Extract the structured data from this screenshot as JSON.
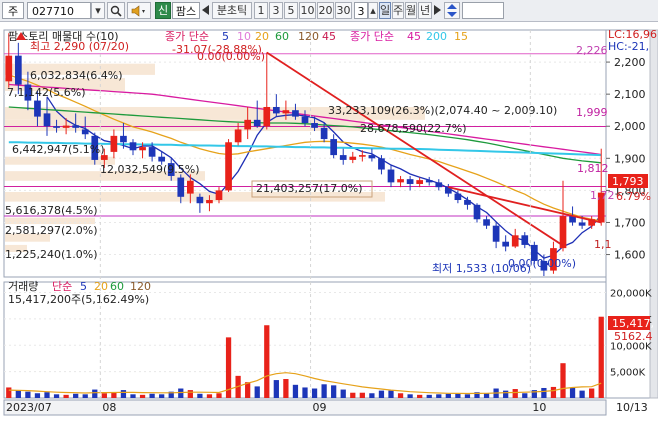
{
  "toolbar": {
    "market": "주",
    "code": "027710",
    "search_icon": "magnifier-icon",
    "sound_icon": "speaker-icon",
    "new_badge": "신",
    "stock_name": "팜스",
    "prev_icon": "triangle-left-icon",
    "tick_label": "분초틱",
    "intervals": [
      "1",
      "3",
      "5",
      "10",
      "20",
      "30"
    ],
    "interval_value": "3",
    "period_tabs": [
      "일",
      "주",
      "월",
      "년"
    ],
    "next_icon": "triangle-right-icon",
    "updown_icon": "updown-arrow-icon"
  },
  "colors": {
    "up": "#e8221a",
    "down": "#1d36b8",
    "ma5": "#1e2fb5",
    "ma10": "#e07bd8",
    "ma20": "#e6a21a",
    "ma60": "#1e9a3c",
    "ma120": "#8a5a2b",
    "ma45": "#d81ba0",
    "ma200": "#33c7e8",
    "trend": "#e02020"
  },
  "chart_data": {
    "type": "candlestick",
    "price_panel": {
      "legend_title": "팜스토리 매물대 수(10)",
      "ma_simple_label": "종가 단순",
      "ma_simple_periods": [
        "5",
        "10",
        "20",
        "60",
        "120"
      ],
      "ma_long_label": "종가 단순",
      "ma_long_periods": [
        "45",
        "200",
        "15"
      ],
      "corner_lc": "LC:16,96",
      "corner_hc": "HC:-21,",
      "y_ticks": [
        "2,200",
        "2,100",
        "2,000",
        "1,900",
        "1,800",
        "1,700",
        "1,600"
      ],
      "ylim": [
        1530,
        2300
      ],
      "high_annotation": "최고 2,290 (07/20)",
      "high_change": "-31.07(-28.88%)",
      "high_zero": "0.00(0.00%)",
      "low_annotation": "최저 1,533 (10/06)",
      "low_change": "0.00(0.00%)",
      "level_labels": {
        "l2226": "2,226",
        "l1999": "1,999",
        "l1812": "1,812",
        "l1793": "1,793",
        "l1720": "1,72",
        "l1628": "1,1",
        "pct": "6.79%"
      },
      "volume_profile": [
        {
          "label": "6,032,834(6.4%)"
        },
        {
          "label": "7,1,142(5.6%)"
        },
        {
          "label": "33,233,109(26.3%)(2,074.40 ~ 2,009.10)"
        },
        {
          "label": "28,678,590(22.7%)"
        },
        {
          "label": "6,442,947(5.1%)"
        },
        {
          "label": "12,032,549(9.5%)"
        },
        {
          "label": "21,403,257(17.0%)"
        },
        {
          "label": "5,616,378(4.5%)"
        },
        {
          "label": "2,581,297(2.0%)"
        },
        {
          "label": "1,225,240(1.0%)"
        }
      ],
      "candles": [
        {
          "o": 2140,
          "h": 2290,
          "l": 2120,
          "c": 2220
        },
        {
          "o": 2220,
          "h": 2260,
          "l": 2100,
          "c": 2130
        },
        {
          "o": 2130,
          "h": 2170,
          "l": 2050,
          "c": 2080
        },
        {
          "o": 2080,
          "h": 2110,
          "l": 2000,
          "c": 2030
        },
        {
          "o": 2040,
          "h": 2090,
          "l": 1970,
          "c": 2000
        },
        {
          "o": 2000,
          "h": 2020,
          "l": 1980,
          "c": 1995
        },
        {
          "o": 1995,
          "h": 2025,
          "l": 1975,
          "c": 2002
        },
        {
          "o": 2003,
          "h": 2040,
          "l": 1980,
          "c": 1995
        },
        {
          "o": 1990,
          "h": 2030,
          "l": 1960,
          "c": 1975
        },
        {
          "o": 1970,
          "h": 1980,
          "l": 1880,
          "c": 1895
        },
        {
          "o": 1895,
          "h": 1930,
          "l": 1870,
          "c": 1910
        },
        {
          "o": 1920,
          "h": 1990,
          "l": 1900,
          "c": 1970
        },
        {
          "o": 1970,
          "h": 2010,
          "l": 1930,
          "c": 1950
        },
        {
          "o": 1950,
          "h": 1960,
          "l": 1910,
          "c": 1925
        },
        {
          "o": 1925,
          "h": 1950,
          "l": 1900,
          "c": 1935
        },
        {
          "o": 1935,
          "h": 1950,
          "l": 1890,
          "c": 1905
        },
        {
          "o": 1905,
          "h": 1920,
          "l": 1880,
          "c": 1890
        },
        {
          "o": 1885,
          "h": 1900,
          "l": 1830,
          "c": 1845
        },
        {
          "o": 1840,
          "h": 1850,
          "l": 1760,
          "c": 1780
        },
        {
          "o": 1790,
          "h": 1850,
          "l": 1760,
          "c": 1830
        },
        {
          "o": 1780,
          "h": 1790,
          "l": 1730,
          "c": 1760
        },
        {
          "o": 1760,
          "h": 1785,
          "l": 1735,
          "c": 1770
        },
        {
          "o": 1770,
          "h": 1810,
          "l": 1760,
          "c": 1800
        },
        {
          "o": 1800,
          "h": 1960,
          "l": 1795,
          "c": 1950
        },
        {
          "o": 1950,
          "h": 2010,
          "l": 1940,
          "c": 1990
        },
        {
          "o": 1990,
          "h": 2060,
          "l": 1960,
          "c": 2020
        },
        {
          "o": 2020,
          "h": 2080,
          "l": 1995,
          "c": 2000
        },
        {
          "o": 2000,
          "h": 2230,
          "l": 1990,
          "c": 2060
        },
        {
          "o": 2060,
          "h": 2100,
          "l": 2030,
          "c": 2040
        },
        {
          "o": 2040,
          "h": 2080,
          "l": 2020,
          "c": 2050
        },
        {
          "o": 2050,
          "h": 2070,
          "l": 2020,
          "c": 2030
        },
        {
          "o": 2030,
          "h": 2050,
          "l": 2000,
          "c": 2010
        },
        {
          "o": 2010,
          "h": 2030,
          "l": 1985,
          "c": 1995
        },
        {
          "o": 1995,
          "h": 2010,
          "l": 1950,
          "c": 1960
        },
        {
          "o": 1960,
          "h": 1975,
          "l": 1900,
          "c": 1910
        },
        {
          "o": 1910,
          "h": 1930,
          "l": 1880,
          "c": 1895
        },
        {
          "o": 1895,
          "h": 1920,
          "l": 1885,
          "c": 1905
        },
        {
          "o": 1905,
          "h": 1925,
          "l": 1890,
          "c": 1910
        },
        {
          "o": 1910,
          "h": 1930,
          "l": 1890,
          "c": 1900
        },
        {
          "o": 1900,
          "h": 1910,
          "l": 1850,
          "c": 1865
        },
        {
          "o": 1865,
          "h": 1880,
          "l": 1810,
          "c": 1825
        },
        {
          "o": 1825,
          "h": 1845,
          "l": 1810,
          "c": 1835
        },
        {
          "o": 1835,
          "h": 1845,
          "l": 1800,
          "c": 1820
        },
        {
          "o": 1820,
          "h": 1840,
          "l": 1810,
          "c": 1832
        },
        {
          "o": 1832,
          "h": 1842,
          "l": 1815,
          "c": 1825
        },
        {
          "o": 1825,
          "h": 1835,
          "l": 1800,
          "c": 1810
        },
        {
          "o": 1810,
          "h": 1820,
          "l": 1780,
          "c": 1790
        },
        {
          "o": 1790,
          "h": 1800,
          "l": 1760,
          "c": 1770
        },
        {
          "o": 1770,
          "h": 1780,
          "l": 1740,
          "c": 1755
        },
        {
          "o": 1755,
          "h": 1760,
          "l": 1700,
          "c": 1710
        },
        {
          "o": 1710,
          "h": 1720,
          "l": 1680,
          "c": 1690
        },
        {
          "o": 1690,
          "h": 1700,
          "l": 1620,
          "c": 1640
        },
        {
          "o": 1640,
          "h": 1660,
          "l": 1610,
          "c": 1625
        },
        {
          "o": 1625,
          "h": 1680,
          "l": 1620,
          "c": 1660
        },
        {
          "o": 1660,
          "h": 1670,
          "l": 1620,
          "c": 1630
        },
        {
          "o": 1630,
          "h": 1640,
          "l": 1570,
          "c": 1580
        },
        {
          "o": 1580,
          "h": 1600,
          "l": 1533,
          "c": 1550
        },
        {
          "o": 1550,
          "h": 1640,
          "l": 1540,
          "c": 1620
        },
        {
          "o": 1620,
          "h": 1830,
          "l": 1610,
          "c": 1720
        },
        {
          "o": 1720,
          "h": 1750,
          "l": 1690,
          "c": 1700
        },
        {
          "o": 1700,
          "h": 1720,
          "l": 1680,
          "c": 1690
        },
        {
          "o": 1690,
          "h": 1720,
          "l": 1680,
          "c": 1710
        },
        {
          "o": 1700,
          "h": 1930,
          "l": 1690,
          "c": 1793
        }
      ],
      "ma_series": [
        {
          "key": "ma5",
          "values": [
            null,
            null,
            null,
            null,
            2092,
            2047,
            2020,
            2003,
            1993,
            1972,
            1955,
            1949,
            1940,
            1930,
            1938,
            1939,
            1921,
            1902,
            1869,
            1840,
            1821,
            1797,
            1788,
            1822,
            1859,
            1912,
            1972,
            2012,
            2030,
            2034,
            2036,
            2032,
            2026,
            2011,
            1982,
            1951,
            1933,
            1921,
            1914,
            1897,
            1879,
            1867,
            1851,
            1841,
            1832,
            1822,
            1807,
            1790,
            1771,
            1749,
            1731,
            1702,
            1674,
            1652,
            1644,
            1614,
            1589,
            1598,
            1625,
            1638,
            1668,
            1688,
            1723
          ]
        },
        {
          "key": "ma20",
          "values": [
            2160,
            2150,
            2140,
            2128,
            2115,
            2100,
            2088,
            2075,
            2062,
            2048,
            2035,
            2022,
            2010,
            1998,
            1990,
            1982,
            1972,
            1962,
            1950,
            1940,
            1930,
            1922,
            1915,
            1912,
            1914,
            1920,
            1925,
            1930,
            1935,
            1940,
            1945,
            1950,
            1952,
            1953,
            1952,
            1950,
            1947,
            1944,
            1940,
            1935,
            1928,
            1920,
            1912,
            1905,
            1898,
            1890,
            1880,
            1870,
            1860,
            1850,
            1838,
            1826,
            1813,
            1800,
            1788,
            1772,
            1757,
            1745,
            1735,
            1725,
            1716,
            1710,
            1705
          ]
        },
        {
          "key": "ma60",
          "values": [
            2060,
            2058,
            2056,
            2054,
            2052,
            2050,
            2048,
            2046,
            2044,
            2042,
            2040,
            2038,
            2036,
            2034,
            2032,
            2030,
            2028,
            2026,
            2024,
            2022,
            2020,
            2018,
            2016,
            2014,
            2013,
            2012,
            2011,
            2010,
            2010,
            2010,
            2009,
            2008,
            2006,
            2004,
            2002,
            2000,
            1998,
            1995,
            1992,
            1989,
            1986,
            1983,
            1980,
            1977,
            1974,
            1970,
            1966,
            1962,
            1958,
            1953,
            1948,
            1942,
            1936,
            1930,
            1924,
            1918,
            1912,
            1906,
            1900,
            1896,
            1892,
            1889,
            1886
          ]
        },
        {
          "key": "ma45",
          "values": [
            2130,
            2128,
            2126,
            2124,
            2122,
            2120,
            2118,
            2116,
            2114,
            2112,
            2110,
            2108,
            2106,
            2104,
            2102,
            2100,
            2096,
            2092,
            2088,
            2084,
            2080,
            2076,
            2072,
            2068,
            2064,
            2060,
            2056,
            2052,
            2048,
            2044,
            2040,
            2036,
            2032,
            2028,
            2024,
            2020,
            2016,
            2012,
            2008,
            2004,
            2000,
            1996,
            1992,
            1988,
            1984,
            1980,
            1976,
            1972,
            1968,
            1964,
            1960,
            1956,
            1952,
            1948,
            1944,
            1940,
            1936,
            1932,
            1928,
            1924,
            1920,
            1916,
            1912
          ]
        },
        {
          "key": "ma200",
          "values": [
            1950,
            1950,
            1949,
            1949,
            1948,
            1948,
            1947,
            1947,
            1946,
            1946,
            1945,
            1945,
            1944,
            1944,
            1943,
            1943,
            1942,
            1942,
            1941,
            1941,
            1940,
            1940,
            1939,
            1939,
            1938,
            1938,
            1937,
            1937,
            1936,
            1936,
            1935,
            1935,
            1934,
            1934,
            1933,
            1933,
            1932,
            1932,
            1931,
            1931,
            1930,
            1930,
            1929,
            1929,
            1928,
            1927,
            1926,
            1925,
            1924,
            1923,
            1922,
            1921,
            1920,
            1919,
            1918,
            1917,
            1916,
            1915,
            1914,
            1913,
            1912,
            1911,
            1910
          ]
        }
      ],
      "trend_lines": [
        {
          "from": [
            27,
            2230
          ],
          "to": [
            58,
            1628
          ]
        },
        {
          "from": [
            46,
            1810
          ],
          "to": [
            62,
            1700
          ]
        }
      ]
    },
    "volume_panel": {
      "title": "거래량",
      "ma_label": "단순",
      "ma_periods": [
        "5",
        "20",
        "60",
        "120"
      ],
      "summary": "15,417,200주(5,162.49%)",
      "y_ticks": [
        "20,000K",
        "15,000K",
        "10,000K",
        "5,000K"
      ],
      "ylim": [
        0,
        22000
      ],
      "last_label": "15,417,",
      "ref_label": "5162.4",
      "values": [
        2000,
        1500,
        1200,
        900,
        1100,
        700,
        600,
        800,
        700,
        1600,
        900,
        1000,
        1500,
        700,
        600,
        800,
        700,
        1200,
        1800,
        1500,
        800,
        700,
        900,
        11500,
        4200,
        3000,
        2200,
        13800,
        3400,
        3600,
        2500,
        2000,
        1800,
        2600,
        2400,
        1600,
        1000,
        1000,
        900,
        1400,
        1400,
        900,
        700,
        600,
        600,
        700,
        800,
        800,
        700,
        1100,
        900,
        1800,
        1400,
        1700,
        900,
        1500,
        1900,
        2100,
        6600,
        2000,
        1400,
        1800,
        15417
      ],
      "ma_line": [
        1500,
        1450,
        1400,
        1300,
        1200,
        1100,
        1050,
        1000,
        950,
        1000,
        1020,
        1040,
        1080,
        1060,
        1020,
        1000,
        980,
        990,
        1050,
        1100,
        1100,
        1080,
        1050,
        1600,
        2200,
        2800,
        3300,
        4200,
        4600,
        4800,
        4600,
        4200,
        3700,
        3300,
        3000,
        2700,
        2400,
        2100,
        1900,
        1700,
        1500,
        1350,
        1200,
        1100,
        1000,
        950,
        900,
        880,
        860,
        880,
        900,
        950,
        1000,
        1050,
        1100,
        1150,
        1250,
        1400,
        1800,
        2000,
        2100,
        2150,
        2800
      ]
    },
    "x_axis": {
      "labels": [
        {
          "text": "2023/07",
          "index": 0
        },
        {
          "text": "08",
          "index": 10
        },
        {
          "text": "09",
          "index": 32
        },
        {
          "text": "10",
          "index": 55
        },
        {
          "text": "10/13",
          "index": 62
        }
      ]
    }
  }
}
